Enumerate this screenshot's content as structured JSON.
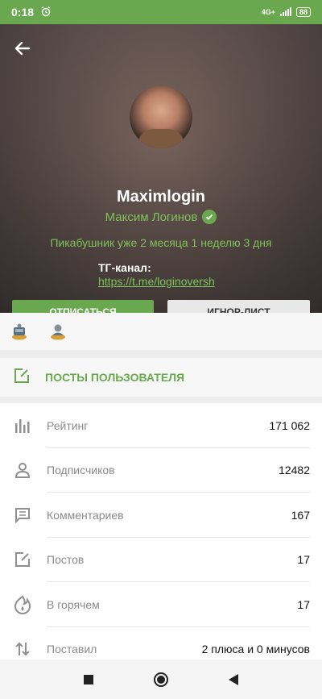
{
  "status_bar": {
    "time": "0:18",
    "network": "4G+",
    "battery": "88"
  },
  "profile": {
    "username": "Maximlogin",
    "real_name": "Максим Логинов",
    "duration": "Пикабушник уже 2 месяца 1 неделю 3 дня",
    "tg_label": "ТГ-канал:",
    "tg_link": "https://t.me/loginoversh",
    "unsubscribe_label": "ОТПИСАТЬСЯ",
    "ignore_label": "ИГНОР-ЛИСТ"
  },
  "awards": [
    "award-badge-1",
    "award-badge-2"
  ],
  "posts_label": "ПОСТЫ ПОЛЬЗОВАТЕЛЯ",
  "stats": [
    {
      "icon": "rating-icon",
      "label": "Рейтинг",
      "value": "171 062"
    },
    {
      "icon": "subscribers-icon",
      "label": "Подписчиков",
      "value": "12482"
    },
    {
      "icon": "comments-icon",
      "label": "Комментариев",
      "value": "167"
    },
    {
      "icon": "posts-icon",
      "label": "Постов",
      "value": "17"
    },
    {
      "icon": "fire-icon",
      "label": "В горячем",
      "value": "17"
    },
    {
      "icon": "votes-icon",
      "label": "Поставил",
      "value": "2 плюса и 0 минусов"
    }
  ],
  "colors": {
    "accent": "#6aa84f",
    "accent_text": "#7fc25a"
  }
}
